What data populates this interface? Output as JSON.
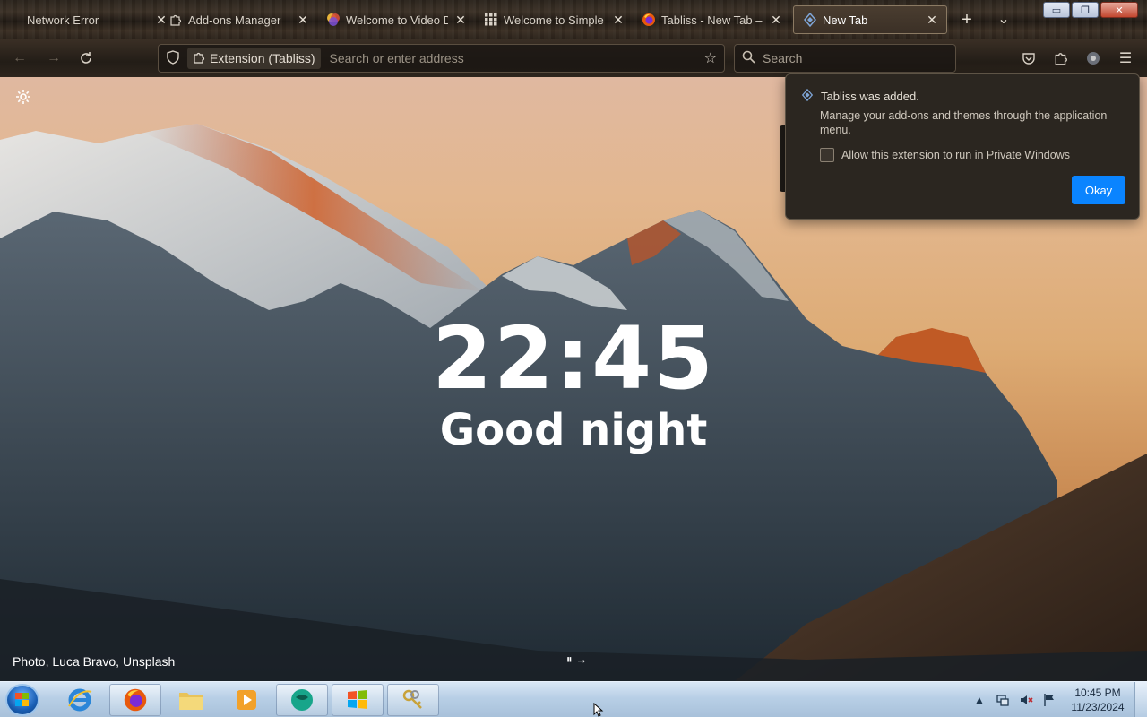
{
  "tabs": [
    {
      "label": "Network Error",
      "icon": "none"
    },
    {
      "label": "Add-ons Manager",
      "icon": "puzzle-icon"
    },
    {
      "label": "Welcome to Video Do",
      "icon": "video-downloader-icon"
    },
    {
      "label": "Welcome to Simple Ta",
      "icon": "grid-icon"
    },
    {
      "label": "Tabliss - New Tab – Ge",
      "icon": "firefox-icon"
    },
    {
      "label": "New Tab",
      "icon": "tabliss-icon",
      "active": true
    }
  ],
  "tab_controls": {
    "new_tab": "+",
    "list_all": "⌄"
  },
  "window_buttons": {
    "minimize": "▭",
    "restore": "❐",
    "close": "✕"
  },
  "navbar": {
    "extension_chip": "Extension (Tabliss)",
    "address_placeholder": "Search or enter address",
    "search_placeholder": "Search"
  },
  "page": {
    "clock": "22:45",
    "greeting": "Good night",
    "credit": "Photo, Luca Bravo, Unsplash"
  },
  "popup": {
    "title": "Tabliss was added.",
    "message": "Manage your add-ons and themes through the application menu.",
    "checkbox_label": "Allow this extension to run in Private Windows",
    "checkbox_checked": false,
    "okay_button": "Okay"
  },
  "taskbar": {
    "pinned": [
      "internet-explorer-icon",
      "firefox-icon",
      "file-explorer-icon",
      "media-player-icon",
      "app-globe-icon",
      "windows-flag-icon",
      "keys-icon"
    ],
    "time": "10:45 PM",
    "date": "11/23/2024"
  },
  "colors": {
    "accent": "#0a84ff"
  }
}
